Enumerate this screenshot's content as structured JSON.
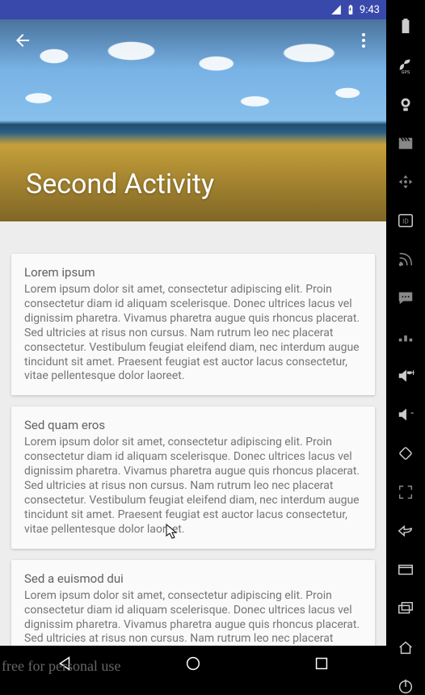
{
  "status": {
    "time": "9:43"
  },
  "hero": {
    "title": "Second Activity"
  },
  "cards": [
    {
      "title": "Lorem ipsum",
      "body": "Lorem ipsum dolor sit amet, consectetur adipiscing elit. Proin consectetur diam id aliquam scelerisque. Donec ultrices lacus vel dignissim pharetra. Vivamus pharetra augue quis rhoncus placerat. Sed ultricies at risus non cursus. Nam rutrum leo nec placerat consectetur. Vestibulum feugiat eleifend diam, nec interdum augue tincidunt sit amet. Praesent feugiat est auctor lacus consectetur, vitae pellentesque dolor laoreet."
    },
    {
      "title": "Sed quam eros",
      "body": "Lorem ipsum dolor sit amet, consectetur adipiscing elit. Proin consectetur diam id aliquam scelerisque. Donec ultrices lacus vel dignissim pharetra. Vivamus pharetra augue quis rhoncus placerat. Sed ultricies at risus non cursus. Nam rutrum leo nec placerat consectetur. Vestibulum feugiat eleifend diam, nec interdum augue tincidunt sit amet. Praesent feugiat est auctor lacus consectetur, vitae pellentesque dolor laoreet."
    },
    {
      "title": "Sed a euismod dui",
      "body": "Lorem ipsum dolor sit amet, consectetur adipiscing elit. Proin consectetur diam id aliquam scelerisque. Donec ultrices lacus vel dignissim pharetra. Vivamus pharetra augue quis rhoncus placerat. Sed ultricies at risus non cursus. Nam rutrum leo nec placerat consectetur. Vestibulum feugiat eleifend diam, nec interdum augue"
    }
  ],
  "watermark": "free for personal use"
}
